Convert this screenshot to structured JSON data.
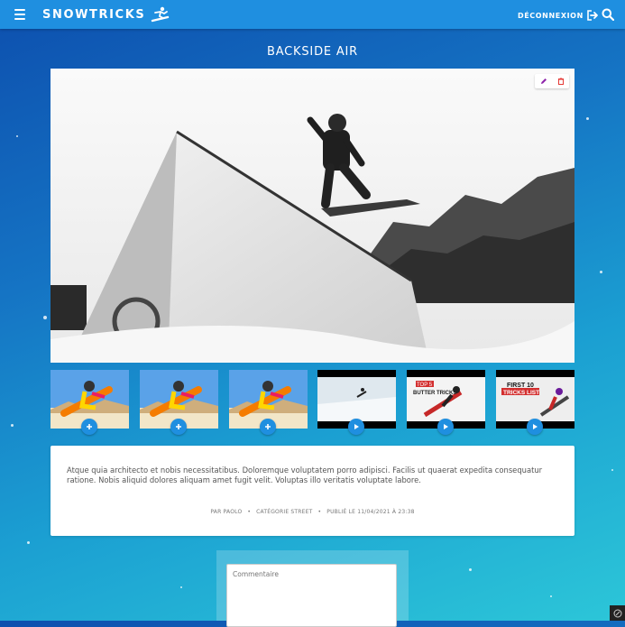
{
  "header": {
    "brand": "SNOWTRICKS",
    "logout_label": "DÉCONNEXION"
  },
  "trick": {
    "title": "BACKSIDE AIR",
    "description": "Atque quia architecto et nobis necessitatibus. Doloremque voluptatem porro adipisci. Facilis ut quaerat expedita consequatur ratione. Nobis aliquid dolores aliquam amet fugit velit. Voluptas illo veritatis voluptate labore.",
    "author": "PAR PAOLO",
    "category": "CATÉGORIE STREET",
    "published": "PUBLIÉ LE 11/04/2021 À 23:38"
  },
  "media": [
    {
      "type": "image",
      "icon": "plus-icon"
    },
    {
      "type": "image",
      "icon": "plus-icon"
    },
    {
      "type": "image",
      "icon": "plus-icon"
    },
    {
      "type": "video",
      "icon": "play-icon"
    },
    {
      "type": "video",
      "icon": "play-icon",
      "label_top": "TOP 5",
      "label_bottom": "BUTTER TRICKS"
    },
    {
      "type": "video",
      "icon": "play-icon",
      "label_top": "FIRST 10",
      "label_bottom": "TRICKS LIST"
    }
  ],
  "comment": {
    "placeholder": "Commentaire"
  },
  "colors": {
    "accent": "#1f8fe0",
    "delete": "#e53935",
    "edit": "#8e24aa"
  }
}
